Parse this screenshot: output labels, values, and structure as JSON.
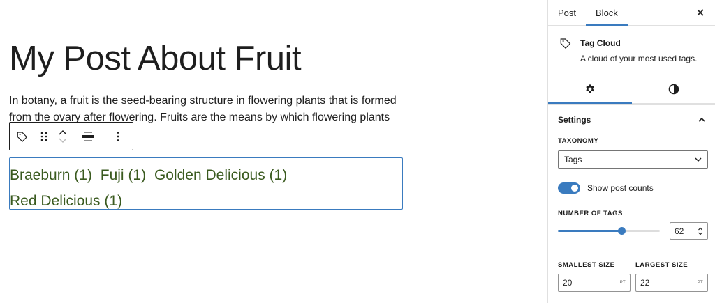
{
  "post": {
    "title": "My Post About Fruit",
    "paragraph": "In botany, a fruit is the seed-bearing structure in flowering plants that is formed from the ovary after flowering. Fruits are the means by which flowering plants"
  },
  "block_toolbar": {
    "block_icon": "tag-icon",
    "drag_icon": "drag-handle-icon",
    "move_up_icon": "chevron-up-icon",
    "move_down_icon": "chevron-down-icon",
    "align_icon": "align-wide-icon",
    "options_icon": "more-vertical-icon"
  },
  "tag_cloud": {
    "tags": [
      {
        "name": "Braeburn",
        "count": "(1)"
      },
      {
        "name": "Fuji",
        "count": "(1)"
      },
      {
        "name": "Golden Delicious",
        "count": "(1)"
      },
      {
        "name": "Red Delicious",
        "count": "(1)"
      }
    ],
    "link_color": "#3a5a1f"
  },
  "sidebar": {
    "tabs": [
      {
        "label": "Post"
      },
      {
        "label": "Block",
        "active": true
      }
    ],
    "close_icon": "close-icon",
    "block_card": {
      "icon": "tag-icon",
      "title": "Tag Cloud",
      "description": "A cloud of your most used tags."
    },
    "style_tabs": [
      {
        "icon": "gear-icon",
        "active": true
      },
      {
        "icon": "contrast-icon",
        "active": false
      }
    ],
    "settings": {
      "title": "Settings",
      "taxonomy_label": "Taxonomy",
      "taxonomy_value": "Tags",
      "show_counts_label": "Show post counts",
      "show_counts_on": true,
      "number_of_tags_label": "Number of tags",
      "number_of_tags_value": "62",
      "number_of_tags_fraction": 0.62,
      "smallest_size_label": "Smallest size",
      "smallest_size_value": "20",
      "largest_size_label": "Largest size",
      "largest_size_value": "22",
      "unit": "PT"
    },
    "accent_color": "#3a7bbf"
  }
}
